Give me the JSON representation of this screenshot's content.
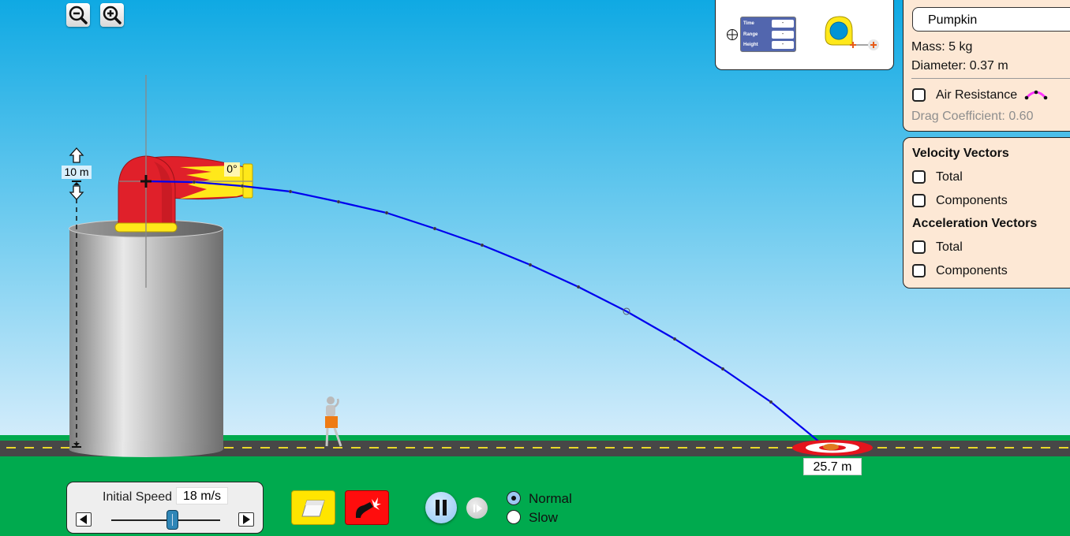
{
  "zoom_controls": {
    "zoom_out_icon": "magnifier-minus-icon",
    "zoom_in_icon": "magnifier-plus-icon"
  },
  "tools": {
    "readout_rows": [
      {
        "label": "Time",
        "value": "-"
      },
      {
        "label": "Range",
        "value": "-"
      },
      {
        "label": "Height",
        "value": "-"
      }
    ],
    "crosshair_icon": "crosshair-icon",
    "tape_measure_icon": "tape-measure-icon"
  },
  "projectile_panel": {
    "selected_projectile": "Pumpkin",
    "mass": "Mass: 5 kg",
    "diameter": "Diameter: 0.37 m",
    "air_resistance_label": "Air Resistance",
    "air_resistance_checked": false,
    "drag_coefficient": "Drag Coefficient: 0.60"
  },
  "vectors_panel": {
    "velocity_title": "Velocity Vectors",
    "velocity_total": "Total",
    "velocity_components": "Components",
    "acceleration_title": "Acceleration Vectors",
    "acceleration_total": "Total",
    "acceleration_components": "Components"
  },
  "scene": {
    "height_label": "10 m",
    "angle_label": "0°",
    "range_label": "25.7 m",
    "colors": {
      "sky_top": "#0fa9e3",
      "sky_bottom": "#d2ecfb",
      "grass": "#00aa4e",
      "road": "#474747",
      "road_line": "#e8d72a",
      "trajectory": "#0000ee",
      "cannon_red": "#e0202a",
      "cannon_yellow": "#ffe81a"
    }
  },
  "speed_control": {
    "label": "Initial Speed",
    "value": "18 m/s",
    "speed_m_s": 18,
    "slider_fraction": 0.56
  },
  "buttons": {
    "erase_icon": "eraser-icon",
    "fire_icon": "cannon-fire-icon",
    "pause_icon": "pause-icon",
    "step_icon": "step-forward-icon"
  },
  "sim_speed": {
    "options": [
      "Normal",
      "Slow"
    ],
    "selected": "Normal"
  }
}
